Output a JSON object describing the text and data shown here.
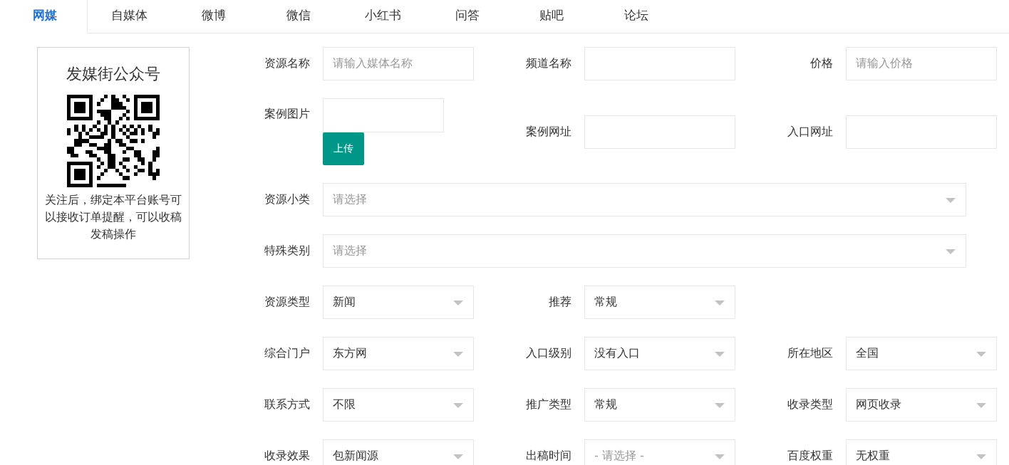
{
  "tabs": [
    {
      "label": "网媒",
      "selected": true
    },
    {
      "label": "自媒体",
      "selected": false
    },
    {
      "label": "微博",
      "selected": false
    },
    {
      "label": "微信",
      "selected": false
    },
    {
      "label": "小红书",
      "selected": false
    },
    {
      "label": "问答",
      "selected": false
    },
    {
      "label": "贴吧",
      "selected": false
    },
    {
      "label": "论坛",
      "selected": false
    }
  ],
  "qr_card": {
    "title": "发媒街公众号",
    "note": "关注后，绑定本平台账号可以接收订单提醒，可以收稿发稿操作"
  },
  "form_rows": [
    {
      "fields": [
        {
          "kind": "text",
          "label": "资源名称",
          "placeholder": "请输入媒体名称"
        },
        {
          "kind": "text",
          "label": "频道名称"
        },
        {
          "kind": "text",
          "label": "价格",
          "placeholder": "请输入价格"
        }
      ]
    },
    {
      "fields": [
        {
          "kind": "upload",
          "label": "案例图片",
          "button": "上传"
        },
        {
          "kind": "text",
          "label": "案例网址"
        },
        {
          "kind": "text",
          "label": "入口网址"
        }
      ]
    },
    {
      "fields": [
        {
          "kind": "wide-select",
          "label": "资源小类",
          "placeholder": "请选择"
        }
      ]
    },
    {
      "fields": [
        {
          "kind": "wide-select",
          "label": "特殊类别",
          "placeholder": "请选择"
        }
      ]
    },
    {
      "fields": [
        {
          "kind": "select",
          "label": "资源类型",
          "value": "新闻"
        },
        {
          "kind": "select",
          "label": "推荐",
          "value": "常规"
        }
      ]
    },
    {
      "fields": [
        {
          "kind": "select",
          "label": "综合门户",
          "value": "东方网"
        },
        {
          "kind": "select",
          "label": "入口级别",
          "value": "没有入口"
        },
        {
          "kind": "select",
          "label": "所在地区",
          "value": "全国"
        }
      ]
    },
    {
      "fields": [
        {
          "kind": "select",
          "label": "联系方式",
          "value": "不限"
        },
        {
          "kind": "select",
          "label": "推广类型",
          "value": "常规"
        },
        {
          "kind": "select",
          "label": "收录类型",
          "value": "网页收录"
        }
      ]
    },
    {
      "fields": [
        {
          "kind": "select",
          "label": "收录效果",
          "value": "包新闻源"
        },
        {
          "kind": "select",
          "label": "出稿时间",
          "placeholder": "- 请选择 -"
        },
        {
          "kind": "select",
          "label": "百度权重",
          "value": "无权重"
        }
      ]
    }
  ]
}
